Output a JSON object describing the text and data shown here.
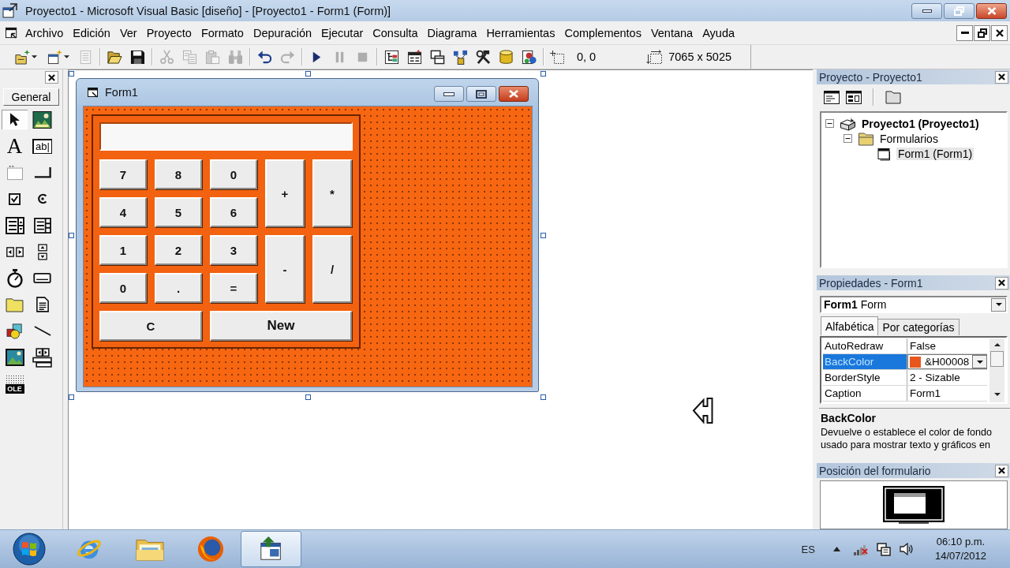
{
  "window": {
    "title": "Proyecto1 - Microsoft Visual Basic [diseño] - [Proyecto1 - Form1 (Form)]"
  },
  "menu_bar": {
    "items": [
      "Archivo",
      "Edición",
      "Ver",
      "Proyecto",
      "Formato",
      "Depuración",
      "Ejecutar",
      "Consulta",
      "Diagrama",
      "Herramientas",
      "Complementos",
      "Ventana",
      "Ayuda"
    ]
  },
  "toolbar": {
    "buttons": [
      {
        "disabled": false
      },
      {
        "disabled": false
      },
      {
        "disabled": true
      },
      {
        "disabled": false
      },
      {
        "disabled": false
      },
      {
        "disabled": true
      },
      {
        "disabled": true
      },
      {
        "disabled": true
      },
      {
        "disabled": true
      },
      {
        "disabled": false
      },
      {
        "disabled": true
      },
      {
        "disabled": false
      },
      {
        "disabled": true
      },
      {
        "disabled": true
      },
      {
        "disabled": false
      },
      {
        "disabled": false
      },
      {
        "disabled": false
      },
      {
        "disabled": false
      },
      {
        "disabled": false
      },
      {
        "disabled": false
      },
      {
        "disabled": false
      }
    ],
    "position": "0, 0",
    "size": "7065 x 5025"
  },
  "toolbox": {
    "tab": "General",
    "tools": [
      {
        "selected": true
      },
      {
        "selected": false
      },
      {
        "glyph": "A",
        "selected": false
      },
      {
        "glyph": "ab|",
        "selected": false
      },
      {
        "selected": false
      },
      {
        "selected": false
      },
      {
        "selected": false
      },
      {
        "selected": false
      },
      {
        "selected": false
      },
      {
        "selected": false
      },
      {
        "selected": false
      },
      {
        "selected": false
      },
      {
        "selected": false
      },
      {
        "selected": false
      },
      {
        "selected": false
      },
      {
        "selected": false
      },
      {
        "selected": false
      },
      {
        "selected": false
      },
      {
        "selected": false
      },
      {
        "selected": false
      },
      {
        "glyph": "OLE",
        "selected": false
      }
    ]
  },
  "form_designer": {
    "form": {
      "title": "Form1",
      "keys": [
        {
          "label": "7",
          "kind": "key"
        },
        {
          "label": "8",
          "kind": "key"
        },
        {
          "label": "0",
          "kind": "key"
        },
        {
          "label": "+",
          "kind": "tall"
        },
        {
          "label": "*",
          "kind": "tall"
        },
        {
          "label": "4",
          "kind": "key"
        },
        {
          "label": "5",
          "kind": "key"
        },
        {
          "label": "6",
          "kind": "key"
        },
        {
          "label": "1",
          "kind": "key"
        },
        {
          "label": "2",
          "kind": "key"
        },
        {
          "label": "3",
          "kind": "key"
        },
        {
          "label": "-",
          "kind": "tall"
        },
        {
          "label": "/",
          "kind": "tall"
        },
        {
          "label": "0",
          "kind": "key"
        },
        {
          "label": ".",
          "kind": "key"
        },
        {
          "label": "=",
          "kind": "key"
        },
        {
          "label": "C",
          "kind": "wide"
        },
        {
          "label": "New",
          "kind": "extra_wide"
        }
      ]
    }
  },
  "project_explorer": {
    "title": "Proyecto - Proyecto1",
    "tree": [
      {
        "label": "Proyecto1 (Proyecto1)",
        "expanded": true,
        "selected": false,
        "children": [
          {
            "label": "Formularios",
            "expanded": true,
            "selected": false,
            "children": [
              {
                "label": "Form1 (Form1)",
                "selected": true
              }
            ]
          }
        ]
      }
    ]
  },
  "properties": {
    "title": "Propiedades - Form1",
    "object": "**Form1** Form",
    "tabs": [
      {
        "label": "Alfabética",
        "selected": true
      },
      {
        "label": "Por categorías",
        "selected": false
      }
    ],
    "rows": [
      {
        "name": "AutoRedraw",
        "value": "False",
        "selected": false
      },
      {
        "name": "BackColor",
        "value": "&H00008",
        "color": "#e8561c",
        "selected": true
      },
      {
        "name": "BorderStyle",
        "value": "2 - Sizable",
        "selected": false
      },
      {
        "name": "Caption",
        "value": "Form1",
        "selected": false
      }
    ],
    "description": {
      "title": "BackColor",
      "text": "Devuelve o establece el color de fondo usado para mostrar texto y gráficos en"
    }
  },
  "form_layout": {
    "title": "Posición del formulario"
  },
  "taskbar": {
    "apps": [
      {
        "selected": false
      },
      {
        "selected": false
      },
      {
        "selected": false
      },
      {
        "selected": true
      }
    ],
    "language": "ES",
    "time": "06:10 p.m.",
    "date": "14/07/2012"
  }
}
